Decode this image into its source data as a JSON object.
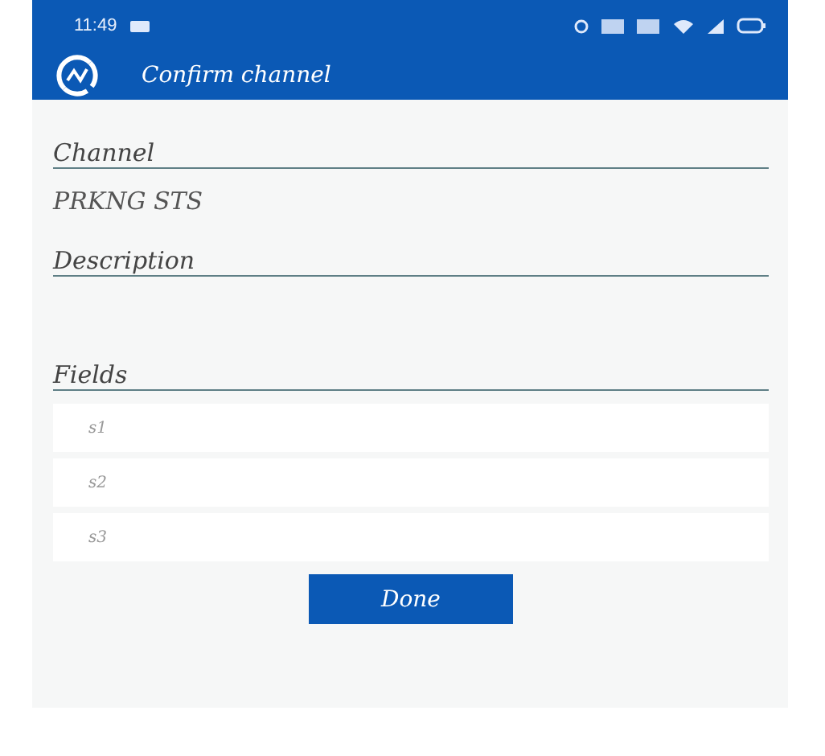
{
  "status_bar": {
    "time": "11:49"
  },
  "app_bar": {
    "title": "Confirm channel"
  },
  "form": [
    {
      "kind": "value",
      "label": "Channel",
      "value": "PRKNG STS"
    },
    {
      "kind": "blank",
      "label": "Description"
    },
    {
      "kind": "list",
      "label": "Fields",
      "items": [
        "s1",
        "s2",
        "s3"
      ]
    }
  ],
  "button": {
    "label": "Done"
  }
}
